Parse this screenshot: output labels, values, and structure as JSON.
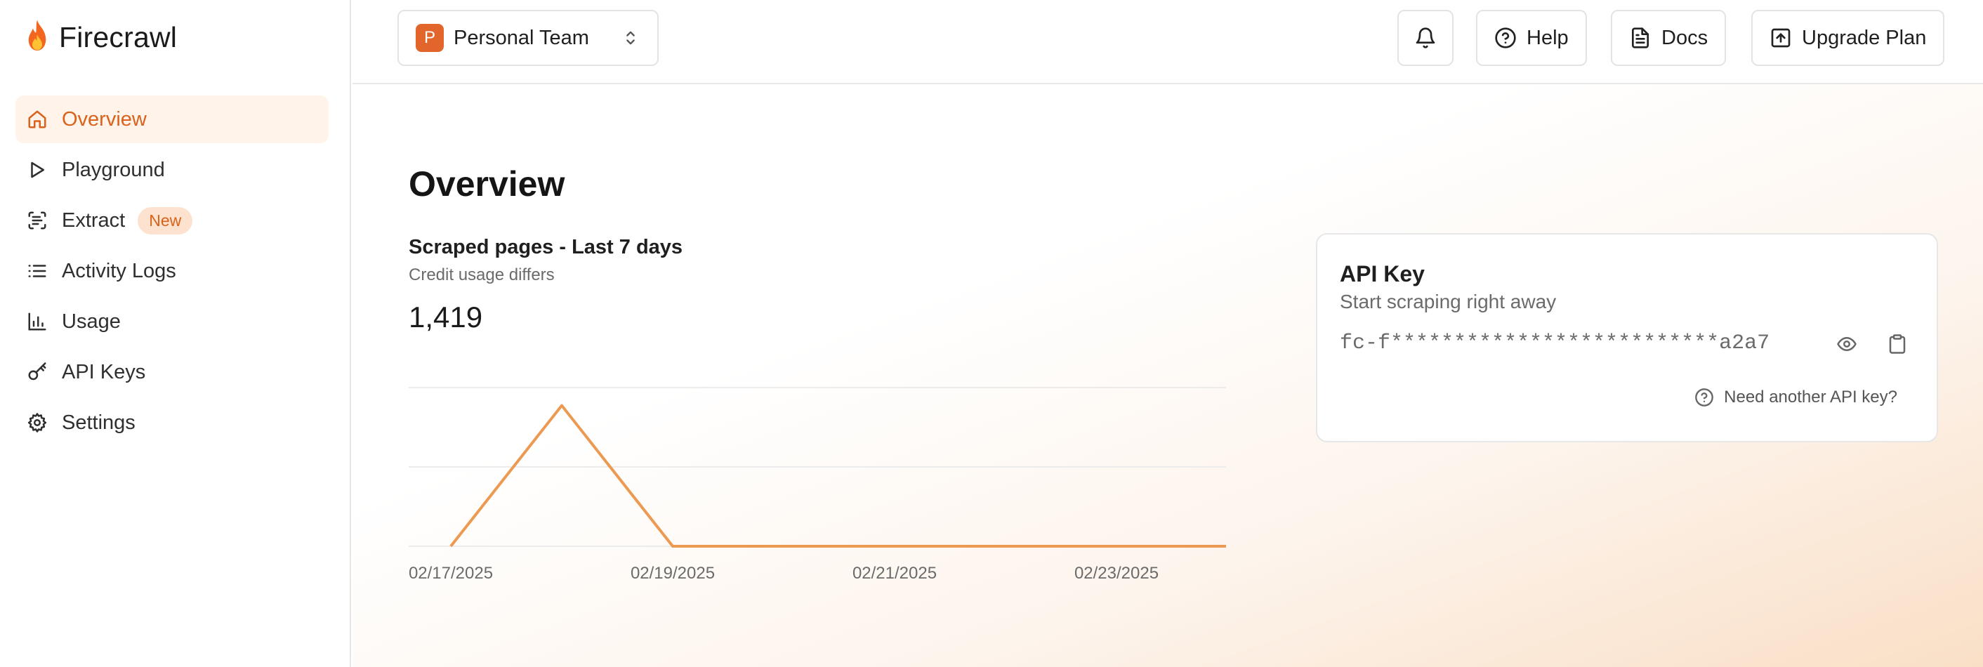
{
  "brand": {
    "name": "Firecrawl",
    "logo_icon": "flame-icon"
  },
  "sidebar": {
    "items": [
      {
        "label": "Overview",
        "icon": "home-icon",
        "active": true
      },
      {
        "label": "Playground",
        "icon": "play-icon"
      },
      {
        "label": "Extract",
        "icon": "scan-text-icon",
        "badge": "New"
      },
      {
        "label": "Activity Logs",
        "icon": "list-icon"
      },
      {
        "label": "Usage",
        "icon": "bar-chart-icon"
      },
      {
        "label": "API Keys",
        "icon": "key-icon"
      },
      {
        "label": "Settings",
        "icon": "gear-icon"
      }
    ]
  },
  "header": {
    "team": {
      "avatar_letter": "P",
      "name": "Personal Team"
    },
    "help_label": "Help",
    "docs_label": "Docs",
    "upgrade_label": "Upgrade Plan"
  },
  "main": {
    "title": "Overview",
    "chart_card": {
      "title": "Scraped pages - Last 7 days",
      "subtitle": "Credit usage differs",
      "total": "1,419"
    },
    "api_card": {
      "title": "API Key",
      "subtitle": "Start scraping right away",
      "masked_key": "fc-f**************************a2a7",
      "help_link": "Need another API key?"
    }
  },
  "colors": {
    "accent": "#d9621c",
    "line": "#ec9a52",
    "brand_avatar": "#e2652b"
  },
  "chart_data": {
    "type": "line",
    "title": "Scraped pages - Last 7 days",
    "x": [
      "02/17/2025",
      "02/18/2025",
      "02/19/2025",
      "02/20/2025",
      "02/21/2025",
      "02/22/2025",
      "02/23/2025",
      "02/24/2025"
    ],
    "tick_labels": [
      "02/17/2025",
      "02/19/2025",
      "02/21/2025",
      "02/23/2025"
    ],
    "series": [
      {
        "values": [
          0,
          1419,
          0,
          0,
          0,
          0,
          0,
          0
        ]
      }
    ],
    "ylim": [
      0,
      1600
    ],
    "grid": true
  }
}
